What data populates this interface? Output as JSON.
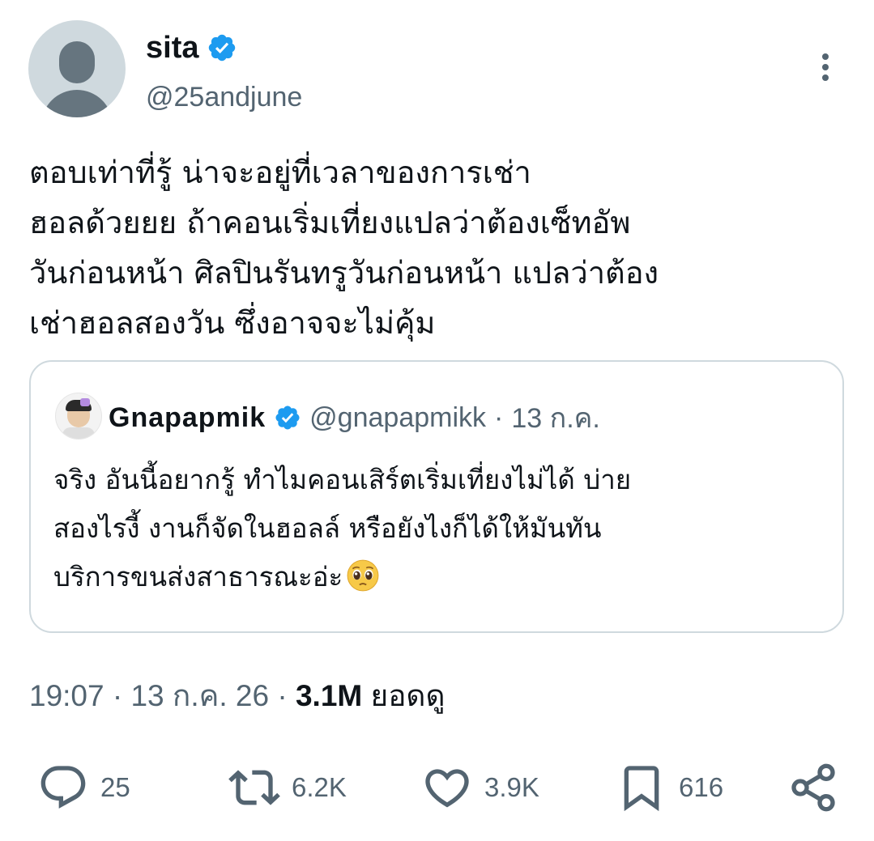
{
  "author": {
    "display_name": "sita",
    "handle": "@25andjune",
    "avatar_icon": "default-avatar-icon",
    "verified_icon": "verified-badge-icon"
  },
  "tweet": {
    "text": "ตอบเท่าที่รู้ น่าจะอยู่ที่เวลาของการเช่า\nฮอลด้วยยย ถ้าคอนเริ่มเที่ยงแปลว่าต้องเซ็ทอัพ\nวันก่อนหน้า ศิลปินรันทรูวันก่อนหน้า แปลว่าต้อง\nเช่าฮอลสองวัน ซึ่งอาจจะไม่คุ้ม"
  },
  "quoted_tweet": {
    "display_name": "Gnapapmik",
    "handle": "@gnapapmikk",
    "separator": "·",
    "date": "13 ก.ค.",
    "text": "จริง อันนี้อยากรู้ ทำไมคอนเสิร์ตเริ่มเที่ยงไม่ได้ บ่าย\nสองไรงี้ งานก็จัดในฮอลล์ หรือยังไงก็ได้ให้มันทัน\nบริการขนส่งสาธารณะอ่ะ",
    "emoji": "pleading-face-emoji"
  },
  "meta": {
    "time": "19:07",
    "separator": "·",
    "date": "13 ก.ค. 26",
    "views_count": "3.1M",
    "views_label": "ยอดดู"
  },
  "actions": {
    "replies": "25",
    "reposts": "6.2K",
    "likes": "3.9K",
    "bookmarks": "616"
  },
  "colors": {
    "text": "#0f1419",
    "secondary": "#536471",
    "verified_blue": "#1d9bf0",
    "border": "#cfd9de"
  }
}
